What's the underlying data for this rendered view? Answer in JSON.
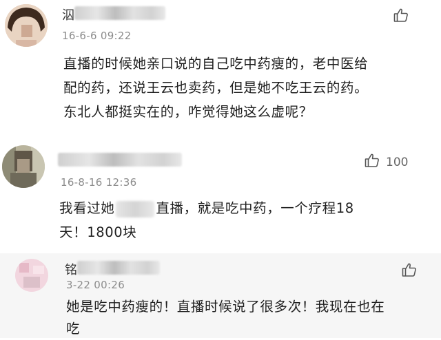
{
  "comments": [
    {
      "name_prefix": "泅",
      "time": "16-6-6 09:22",
      "body_lines": [
        "直播的时候她亲口说的自己吃中药瘦的，老中医给",
        "配的药，还说王云也卖药，但是她不吃王云的药。",
        "东北人都挺实在的，咋觉得她这么虚呢？"
      ],
      "likes": ""
    },
    {
      "name_prefix": "",
      "time": "16-8-16 12:36",
      "body_line1_a": "我看过她",
      "body_line1_b": "直播，就是吃中药，一个疗程18",
      "body_line2": "天！1800块",
      "likes": "100"
    },
    {
      "name_prefix": "铭",
      "time": "3-22 00:26",
      "body_lines": [
        "她是吃中药瘦的！直播时候说了很多次！我现在也在",
        "吃"
      ],
      "likes": ""
    }
  ],
  "colors": {
    "background": "#ffffff",
    "reply_background": "#f6f6f6",
    "time": "#8c8c8c",
    "body_text": "#1f1f1f",
    "like_icon": "#555555"
  },
  "icons": {
    "like": "thumbs-up-icon"
  }
}
